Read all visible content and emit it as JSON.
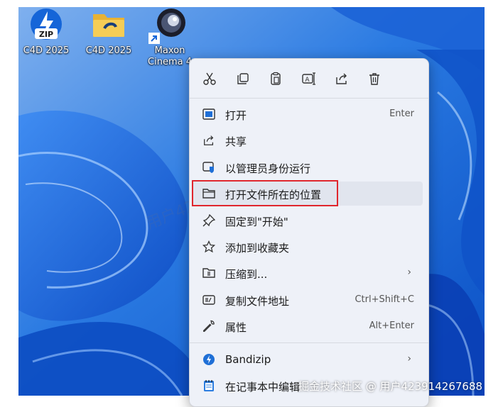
{
  "desktop": {
    "icons": [
      {
        "label": "C4D 2025",
        "badge": "ZIP"
      },
      {
        "label": "C4D 2025"
      },
      {
        "label": "Maxon Cinema 4"
      }
    ]
  },
  "context_menu": {
    "quick_actions": [
      "cut",
      "copy",
      "paste",
      "rename",
      "share",
      "delete"
    ],
    "items": [
      {
        "label": "打开",
        "shortcut": "Enter"
      },
      {
        "label": "共享"
      },
      {
        "label": "以管理员身份运行"
      },
      {
        "label": "打开文件所在的位置"
      },
      {
        "label": "固定到\"开始\""
      },
      {
        "label": "添加到收藏夹"
      },
      {
        "label": "压缩到...",
        "submenu": "›"
      },
      {
        "label": "复制文件地址",
        "shortcut": "Ctrl+Shift+C"
      },
      {
        "label": "属性",
        "shortcut": "Alt+Enter"
      },
      {
        "label": "Bandizip",
        "submenu": "›"
      },
      {
        "label": "在记事本中编辑"
      }
    ]
  },
  "watermark": {
    "diagonal": "用户4239142676688",
    "footer": "掘金技术社区 @ 用户423914267688"
  },
  "colors": {
    "highlight_box": "#e0262d",
    "menu_bg": "#eef1f8",
    "accent": "#1f6fd6"
  }
}
